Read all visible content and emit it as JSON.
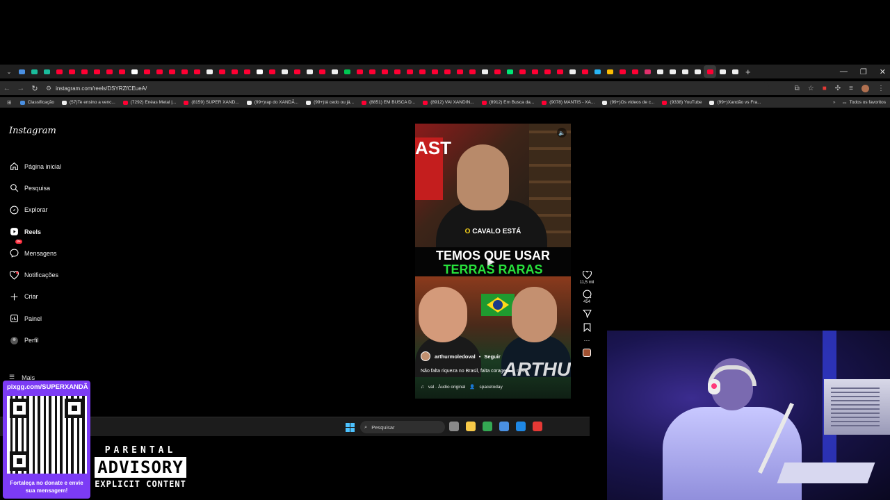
{
  "browser": {
    "tab_colors": [
      "#4a90e2",
      "#1abc9c",
      "#1abc9c",
      "#ff0033",
      "#ff0033",
      "#ff0033",
      "#ff0033",
      "#ff0033",
      "#ff0033",
      "#ffffff",
      "#ff0033",
      "#ff0033",
      "#ff0033",
      "#ff0033",
      "#ff0033",
      "#eeeeee",
      "#ff0033",
      "#ff0033",
      "#ff0033",
      "#ffffff",
      "#ff0033",
      "#eeeeee",
      "#ff0033",
      "#eeeeee",
      "#ff0033",
      "#eeeeee",
      "#00c853",
      "#ff0033",
      "#ff0033",
      "#ff0033",
      "#ff0033",
      "#ff0033",
      "#ff0033",
      "#ff0033",
      "#ff0033",
      "#ff0033",
      "#ff0033",
      "#eeeeee",
      "#ff0033",
      "#00e676",
      "#ff0033",
      "#ff0033",
      "#ff0033",
      "#ff0033",
      "#eeeeee",
      "#ff0033",
      "#29b6f6",
      "#fbbc04",
      "#ff0033",
      "#ff0033",
      "#e1306c",
      "#eeeeee",
      "#eeeeee",
      "#eeeeee",
      "#eeeeee",
      "#ff0033",
      "#eeeeee",
      "#eeeeee"
    ],
    "url": "instagram.com/reels/DSYRZfCEueA/",
    "bookmarks": [
      {
        "label": "Classificação",
        "color": "#4a90e2"
      },
      {
        "label": "(57)Te ensino a venc...",
        "color": "#eeeeee"
      },
      {
        "label": "(7292) Enéas Metal |...",
        "color": "#ff0033"
      },
      {
        "label": "(8159) SUPER XAND...",
        "color": "#ff0033"
      },
      {
        "label": "(99+)rap do XANDÃ...",
        "color": "#eeeeee"
      },
      {
        "label": "(99+)tá cedo ou já...",
        "color": "#eeeeee"
      },
      {
        "label": "(8851) EM BUSCA D...",
        "color": "#ff0033"
      },
      {
        "label": "(8912) VAI XANDIN...",
        "color": "#ff0033"
      },
      {
        "label": "(8912) Em Busca da...",
        "color": "#ff0033"
      },
      {
        "label": "(9078) MANTIS - XA...",
        "color": "#ff0033"
      },
      {
        "label": "(99+)Os vídeos de c...",
        "color": "#eeeeee"
      },
      {
        "label": "(9338) YouTube",
        "color": "#ff0033"
      },
      {
        "label": "(99+)Xandão vs Fra...",
        "color": "#eeeeee"
      }
    ],
    "bookmarks_folder": "Todos os favoritos"
  },
  "instagram": {
    "logo": "Instagram",
    "nav": [
      {
        "label": "Página inicial",
        "icon": "home-icon"
      },
      {
        "label": "Pesquisa",
        "icon": "search-icon"
      },
      {
        "label": "Explorar",
        "icon": "compass-icon"
      },
      {
        "label": "Reels",
        "icon": "reels-icon"
      },
      {
        "label": "Mensagens",
        "icon": "messenger-icon"
      },
      {
        "label": "Notificações",
        "icon": "heart-icon"
      },
      {
        "label": "Criar",
        "icon": "plus-icon"
      },
      {
        "label": "Painel",
        "icon": "dashboard-icon"
      },
      {
        "label": "Perfil",
        "icon": "avatar-icon"
      }
    ],
    "messages_badge": "9+",
    "more_label": "Mais",
    "reel": {
      "video_text_ast": "AST",
      "subtitle_prefix": "O ",
      "subtitle_main": "CAVALO ESTÁ",
      "headline_line1": "TEMOS QUE USAR",
      "headline_line2": "TERRAS RARAS",
      "overlay_name": "ARTHU",
      "author": "arthurmoledoval",
      "follow": "Seguir",
      "caption": "Não falta riqueza no Brasil, falta coragem",
      "caption_more": "... mais",
      "audio": "val · Áudio original",
      "audio_user": "spacetoday"
    },
    "actions": {
      "likes": "11,5 mil",
      "comments": "454"
    }
  },
  "taskbar": {
    "search_placeholder": "Pesquisar",
    "apps": [
      "#8a8a8a",
      "#f7c948",
      "#34a853",
      "#4a90e2",
      "#1e88e5",
      "#e53935"
    ]
  },
  "overlay": {
    "donate_url": "pixgg.com/SUPERXANDÃ",
    "donate_note": "Fortaleça no donate e envie sua mensagem!",
    "pa_line1": "PARENTAL",
    "pa_line2": "ADVISORY",
    "pa_line3": "EXPLICIT CONTENT"
  }
}
